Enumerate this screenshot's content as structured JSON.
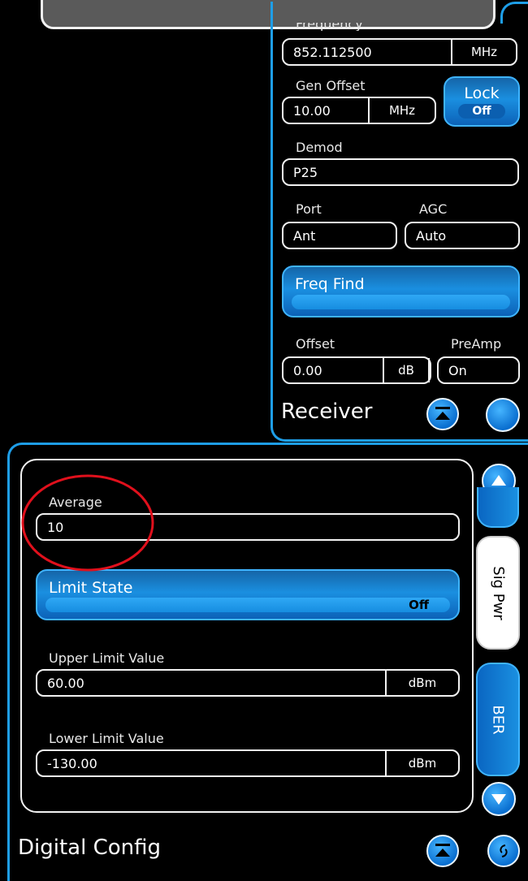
{
  "receiver": {
    "frequency_label": "Frequency",
    "frequency_value": "852.112500",
    "frequency_unit": "MHz",
    "gen_offset_label": "Gen Offset",
    "gen_offset_value": "10.00",
    "gen_offset_unit": "MHz",
    "lock_label": "Lock",
    "lock_state": "Off",
    "demod_label": "Demod",
    "demod_value": "P25",
    "port_label": "Port",
    "port_value": "Ant",
    "agc_label": "AGC",
    "agc_value": "Auto",
    "freq_find_label": "Freq Find",
    "offset_label": "Offset",
    "offset_value": "0.00",
    "offset_unit": "dB",
    "preamp_label": "PreAmp",
    "preamp_value": "On",
    "title": "Receiver"
  },
  "digital_config": {
    "title": "Digital Config",
    "average_label": "Average",
    "average_value": "10",
    "limit_state_label": "Limit State",
    "limit_state_value": "Off",
    "upper_limit_label": "Upper Limit Value",
    "upper_limit_value": "60.00",
    "upper_limit_unit": "dBm",
    "lower_limit_label": "Lower Limit Value",
    "lower_limit_value": "-130.00",
    "lower_limit_unit": "dBm",
    "tabs": [
      {
        "label": "Sig Pwr",
        "selected": true
      },
      {
        "label": "BER",
        "selected": false
      }
    ]
  },
  "colors": {
    "accent": "#1e9ee8",
    "annotation": "#e0101c"
  }
}
